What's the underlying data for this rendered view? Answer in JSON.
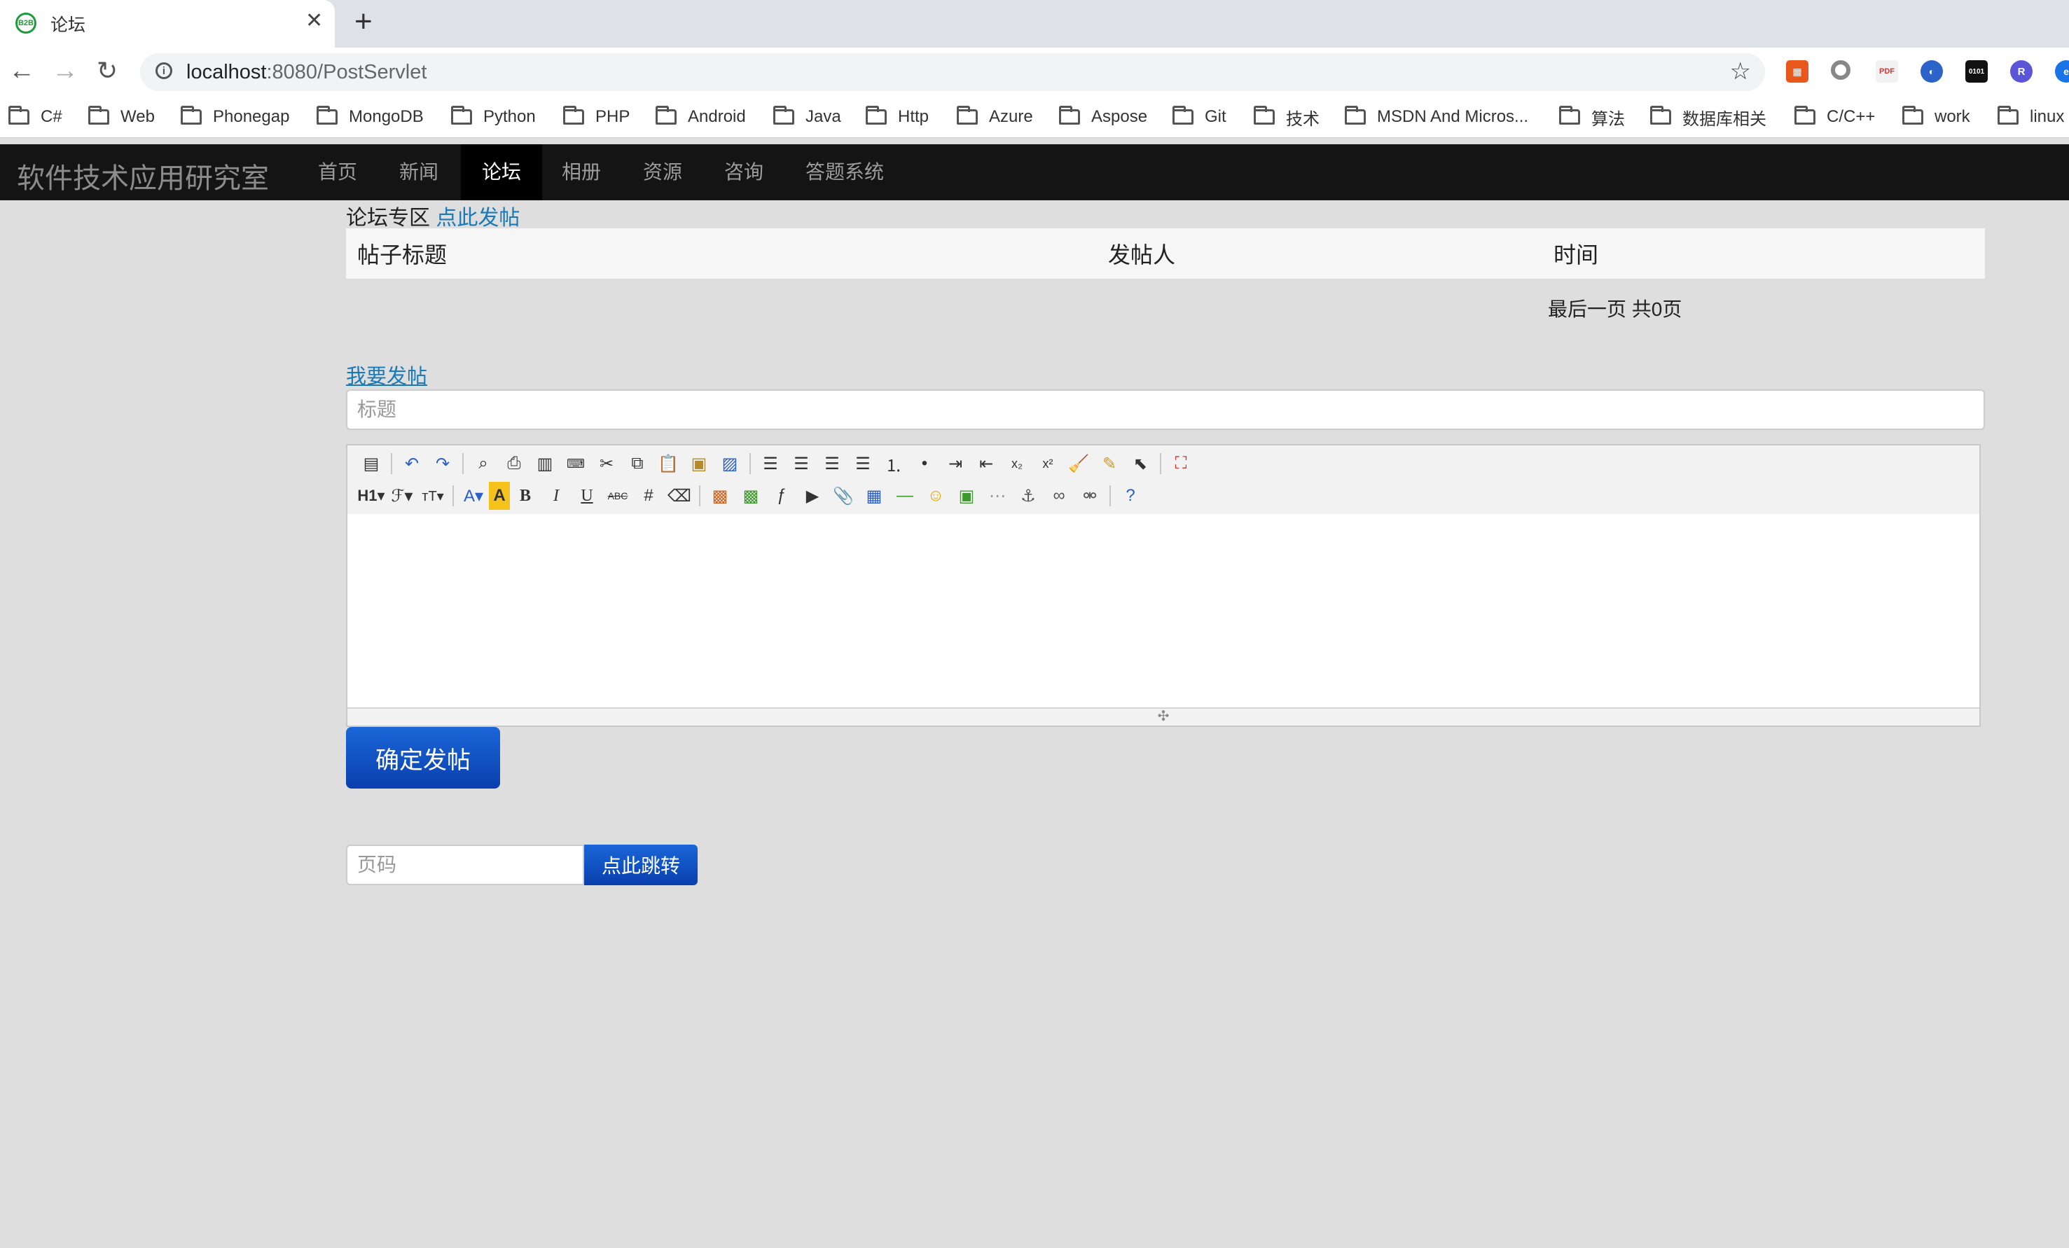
{
  "browser": {
    "tab_title": "论坛",
    "url_host": "localhost",
    "url_rest": ":8080/PostServlet",
    "bookmarks": [
      "C#",
      "Web",
      "Phonegap",
      "MongoDB",
      "Python",
      "PHP",
      "Android",
      "Java",
      "Http",
      "Azure",
      "Aspose",
      "Git",
      "技术",
      "MSDN And Micros...",
      "算法",
      "数据库相关",
      "C/C++",
      "work",
      "linux"
    ]
  },
  "site": {
    "brand": "软件技术应用研究室",
    "nav": [
      "首页",
      "新闻",
      "论坛",
      "相册",
      "资源",
      "咨询",
      "答题系统"
    ],
    "active_nav": "论坛"
  },
  "forum": {
    "heading": "论坛专区",
    "post_link": "点此发帖",
    "columns": [
      "帖子标题",
      "发帖人",
      "时间"
    ],
    "rows": [],
    "pager_text": "最后一页 共0页"
  },
  "new_post": {
    "link": "我要发帖",
    "title_placeholder": "标题",
    "submit_label": "确定发帖"
  },
  "jump": {
    "placeholder": "页码",
    "button_label": "点此跳转"
  },
  "editor_icons_row1": [
    "source",
    "undo",
    "redo",
    "preview",
    "print",
    "template",
    "insert-code",
    "cut",
    "copy",
    "paste",
    "paste-text",
    "paste-word",
    "align-left",
    "align-center",
    "align-right",
    "justify",
    "ordered-list",
    "unordered-list",
    "indent",
    "outdent",
    "subscript",
    "superscript",
    "clear-format",
    "select-all",
    "quick-format",
    "fullscreen"
  ],
  "editor_icons_row2": [
    "heading",
    "font-family",
    "font-size",
    "font-color",
    "highlight",
    "bold",
    "italic",
    "underline",
    "strikethrough",
    "line-height",
    "remove-format",
    "image",
    "multi-image",
    "flash",
    "media",
    "file",
    "table",
    "hr",
    "emoticon",
    "baidu-map",
    "pagebreak",
    "anchor",
    "link",
    "unlink",
    "about"
  ]
}
